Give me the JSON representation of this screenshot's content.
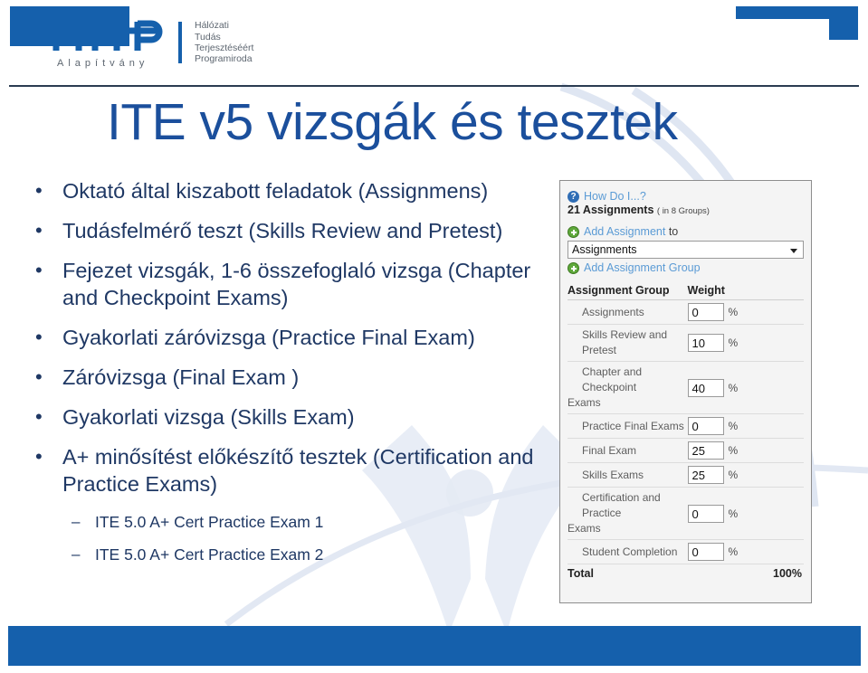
{
  "slide": {
    "title": "ITE v5 vizsgák és tesztek",
    "accent_blue": "#1560ac",
    "title_blue": "#1b4f9c",
    "body_navy": "#1f3864"
  },
  "logo": {
    "wordmark": "HTTP",
    "subtitle": "Alapítvány",
    "org_lines": "Hálózati\nTudás\nTerjesztéséért\nProgramiroda"
  },
  "bullets": [
    {
      "mark": "•",
      "text": "Oktató által kiszabott feladatok (Assignmens)"
    },
    {
      "mark": "•",
      "text": "Tudásfelmérő teszt (Skills Review and Pretest)"
    },
    {
      "mark": "•",
      "text": "Fejezet vizsgák,  1-6 összefoglaló vizsga (Chapter and Checkpoint Exams)"
    },
    {
      "mark": "•",
      "text": "Gyakorlati záróvizsga (Practice Final Exam)"
    },
    {
      "mark": "•",
      "text": "Záróvizsga (Final Exam )"
    },
    {
      "mark": "•",
      "text": "Gyakorlati vizsga (Skills Exam)"
    },
    {
      "mark": "•",
      "text": "A+ minősítést előkészítő tesztek (Certification and Practice Exams)"
    }
  ],
  "sub_bullets": [
    {
      "mark": "–",
      "text": "ITE 5.0 A+ Cert Practice Exam 1"
    },
    {
      "mark": "–",
      "text": "ITE 5.0 A+ Cert Practice Exam 2"
    }
  ],
  "panel": {
    "help_link": "How Do I...?",
    "help_icon_glyph": "?",
    "assignments_count": "21 Assignments",
    "assignments_groups": "( in 8 Groups)",
    "add_assignment_link": "Add Assignment",
    "add_assignment_suffix": " to",
    "group_select_value": "Assignments",
    "add_group_link": "Add Assignment Group",
    "table": {
      "headers": [
        "Assignment Group",
        "Weight"
      ],
      "percent_symbol": "%",
      "rows": [
        {
          "name": "Assignments",
          "name_tail": "",
          "weight": "0"
        },
        {
          "name": "Skills Review and Pretest",
          "name_tail": "",
          "weight": "10"
        },
        {
          "name": "Chapter and Checkpoint",
          "name_tail": "Exams",
          "weight": "40"
        },
        {
          "name": "Practice Final Exams",
          "name_tail": "",
          "weight": "0"
        },
        {
          "name": "Final Exam",
          "name_tail": "",
          "weight": "25"
        },
        {
          "name": "Skills Exams",
          "name_tail": "",
          "weight": "25"
        },
        {
          "name": "Certification and Practice",
          "name_tail": "Exams",
          "weight": "0"
        },
        {
          "name": "Student Completion",
          "name_tail": "",
          "weight": "0"
        }
      ],
      "total_label": "Total",
      "total_value": "100%"
    }
  }
}
